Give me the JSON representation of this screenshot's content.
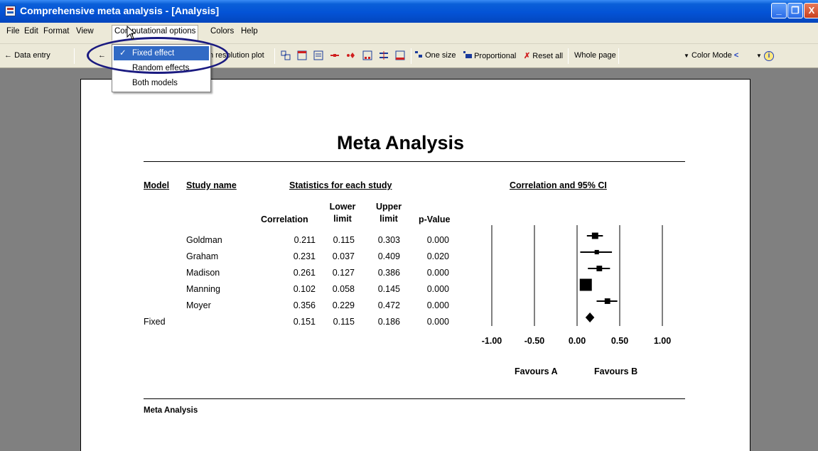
{
  "window": {
    "title": "Comprehensive meta analysis - [Analysis]",
    "controls": [
      "_",
      "❐",
      "X"
    ]
  },
  "menubar": {
    "items": [
      "File",
      "Edit",
      "Format",
      "View",
      "Computational options",
      "Colors",
      "Help"
    ]
  },
  "toolbar": {
    "data_entry": "Data entry",
    "high_res_plot": "h resolution plot",
    "one_size": "One size",
    "proportional": "Proportional",
    "reset_all": "Reset all",
    "whole_page": "Whole page",
    "color_mode": "Color Mode"
  },
  "dropdown": {
    "options": [
      {
        "label": "Fixed effect",
        "checked": true,
        "highlighted": true
      },
      {
        "label": "Random effects",
        "checked": false,
        "highlighted": false
      },
      {
        "label": "Both models",
        "checked": false,
        "highlighted": false
      }
    ]
  },
  "report": {
    "title": "Meta Analysis",
    "footer": "Meta Analysis",
    "headers": {
      "model": "Model",
      "study_name": "Study name",
      "stats_group": "Statistics for each study",
      "ci_group": "Correlation and 95% CI",
      "correlation": "Correlation",
      "lower1": "Lower",
      "lower2": "limit",
      "upper1": "Upper",
      "upper2": "limit",
      "pvalue": "p-Value"
    },
    "studies": [
      {
        "name": "Goldman",
        "correlation": "0.211",
        "lower": "0.115",
        "upper": "0.303",
        "p": "0.000",
        "r": 0.211,
        "lo": 0.115,
        "hi": 0.303,
        "weight": 0.18
      },
      {
        "name": "Graham",
        "correlation": "0.231",
        "lower": "0.037",
        "upper": "0.409",
        "p": "0.020",
        "r": 0.231,
        "lo": 0.037,
        "hi": 0.409,
        "weight": 0.05
      },
      {
        "name": "Madison",
        "correlation": "0.261",
        "lower": "0.127",
        "upper": "0.386",
        "p": "0.000",
        "r": 0.261,
        "lo": 0.127,
        "hi": 0.386,
        "weight": 0.12
      },
      {
        "name": "Manning",
        "correlation": "0.102",
        "lower": "0.058",
        "upper": "0.145",
        "p": "0.000",
        "r": 0.102,
        "lo": 0.058,
        "hi": 0.145,
        "weight": 1.0
      },
      {
        "name": "Moyer",
        "correlation": "0.356",
        "lower": "0.229",
        "upper": "0.472",
        "p": "0.000",
        "r": 0.356,
        "lo": 0.229,
        "hi": 0.472,
        "weight": 0.12
      }
    ],
    "summary": {
      "model": "Fixed",
      "correlation": "0.151",
      "lower": "0.115",
      "upper": "0.186",
      "p": "0.000",
      "r": 0.151,
      "lo": 0.115,
      "hi": 0.186
    },
    "axis_ticks": [
      "-1.00",
      "-0.50",
      "0.00",
      "0.50",
      "1.00"
    ],
    "axis_values": [
      -1,
      -0.5,
      0,
      0.5,
      1
    ],
    "favours_a": "Favours A",
    "favours_b": "Favours B"
  }
}
